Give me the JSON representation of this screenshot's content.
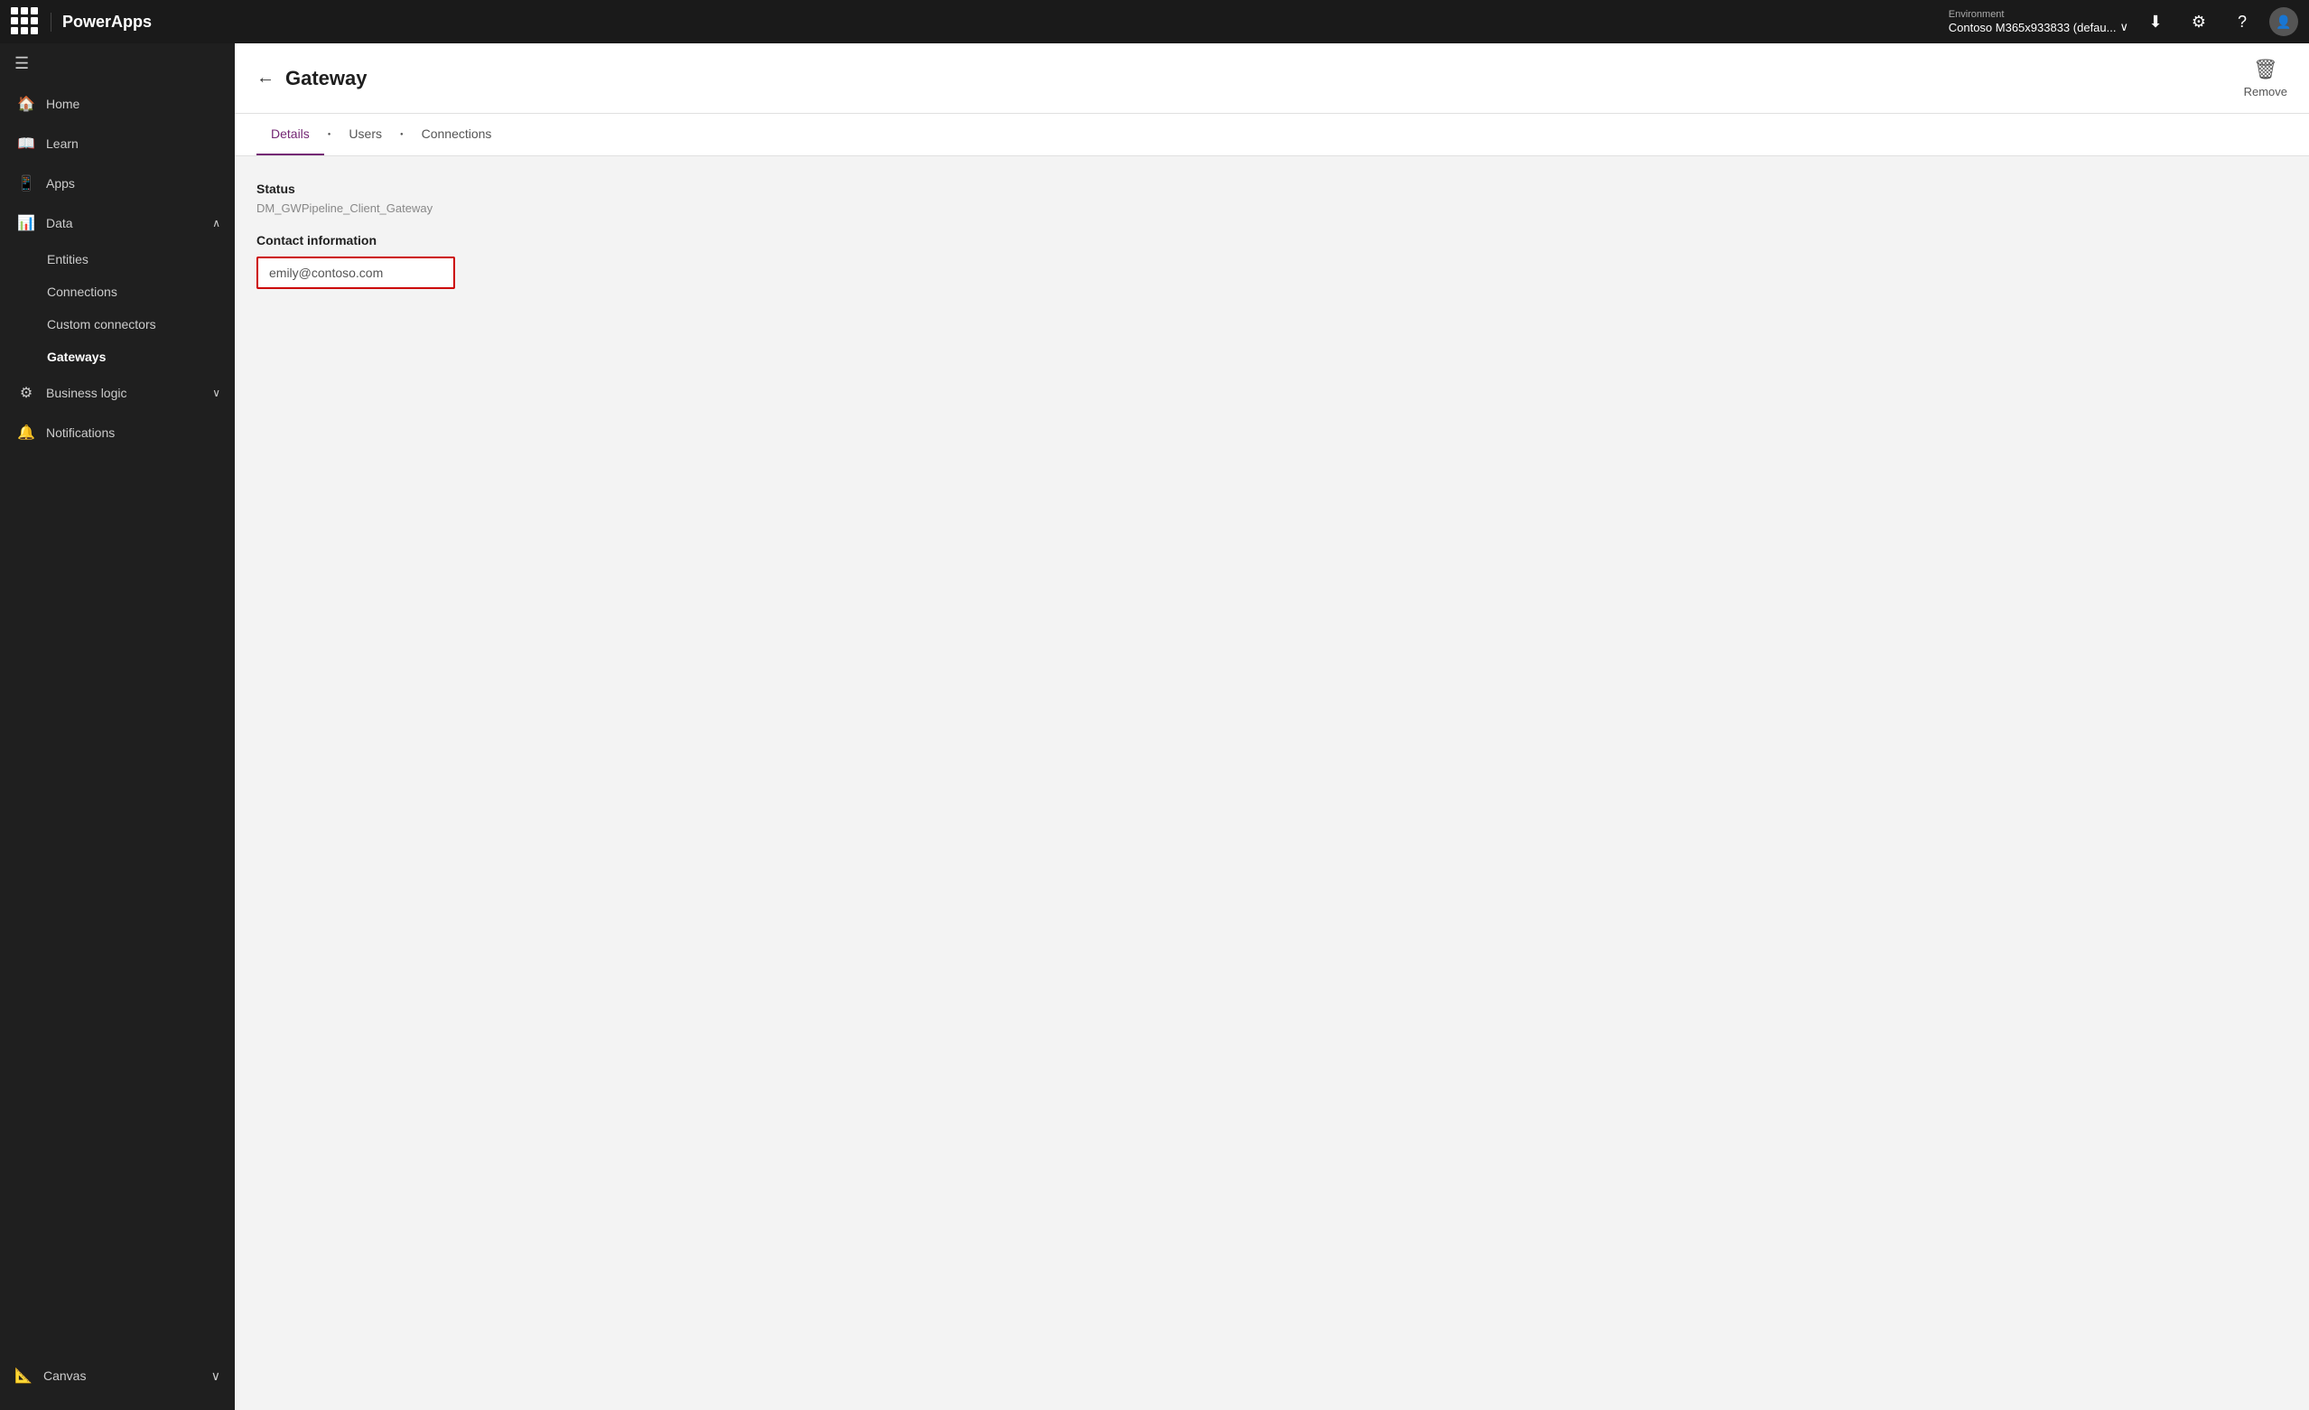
{
  "topbar": {
    "brand": "PowerApps",
    "env_label": "Environment",
    "env_value": "Contoso M365x933833 (defau...",
    "download_icon": "⬇",
    "settings_icon": "⚙",
    "help_icon": "?",
    "avatar_text": "👤"
  },
  "sidebar": {
    "menu_icon": "☰",
    "items": [
      {
        "id": "home",
        "icon": "🏠",
        "label": "Home",
        "active": false
      },
      {
        "id": "learn",
        "icon": "📖",
        "label": "Learn",
        "active": false
      },
      {
        "id": "apps",
        "icon": "📱",
        "label": "Apps",
        "active": false
      },
      {
        "id": "data",
        "icon": "📊",
        "label": "Data",
        "active": false,
        "expanded": true,
        "chevron": "∧"
      }
    ],
    "sub_items": [
      {
        "id": "entities",
        "label": "Entities",
        "active": false
      },
      {
        "id": "connections",
        "label": "Connections",
        "active": false
      },
      {
        "id": "custom-connectors",
        "label": "Custom connectors",
        "active": false
      },
      {
        "id": "gateways",
        "label": "Gateways",
        "active": true
      }
    ],
    "bottom_items": [
      {
        "id": "business-logic",
        "icon": "⚙",
        "label": "Business logic",
        "chevron": "∨"
      },
      {
        "id": "notifications",
        "icon": "🔔",
        "label": "Notifications"
      }
    ],
    "footer": {
      "label": "Canvas",
      "chevron": "∨",
      "icon": "📐"
    }
  },
  "page": {
    "title": "Gateway",
    "back_label": "←",
    "remove_label": "Remove"
  },
  "tabs": [
    {
      "id": "details",
      "label": "Details",
      "active": true
    },
    {
      "id": "users",
      "label": "Users",
      "active": false
    },
    {
      "id": "connections",
      "label": "Connections",
      "active": false
    }
  ],
  "content": {
    "status_label": "Status",
    "status_value": "DM_GWPipeline_Client_Gateway",
    "contact_label": "Contact information",
    "contact_value": "emily@contoso.com",
    "contact_placeholder": "emily@contoso.com"
  }
}
